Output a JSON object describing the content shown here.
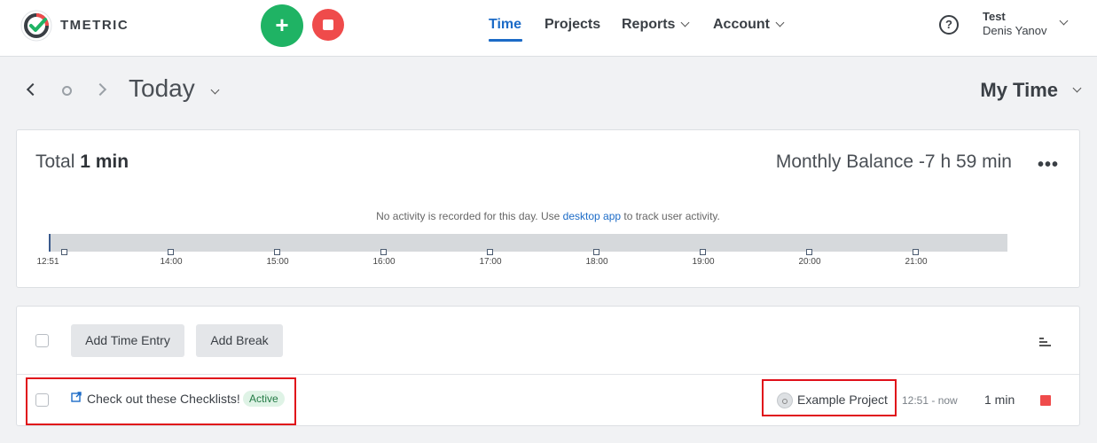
{
  "header": {
    "brand": "TMETRIC",
    "start_button": "+",
    "nav": [
      {
        "label": "Time",
        "active": true
      },
      {
        "label": "Projects",
        "active": false
      },
      {
        "label": "Reports",
        "active": false,
        "dropdown": true
      },
      {
        "label": "Account",
        "active": false,
        "dropdown": true
      }
    ],
    "help": "?",
    "user": {
      "workspace": "Test",
      "name": "Denis Yanov"
    }
  },
  "datebar": {
    "title": "Today",
    "view": "My Time"
  },
  "summary": {
    "total_label": "Total",
    "total_value": "1 min",
    "balance_label": "Monthly Balance",
    "balance_value": "-7 h 59 min",
    "more": "•••",
    "activity_note_before": "No activity is recorded for this day. Use ",
    "activity_note_link": "desktop app",
    "activity_note_after": " to track user activity.",
    "timeline_ticks": [
      "12:51",
      "14:00",
      "15:00",
      "16:00",
      "17:00",
      "18:00",
      "19:00",
      "20:00",
      "21:00"
    ]
  },
  "entries": {
    "add_time_entry": "Add Time Entry",
    "add_break": "Add Break",
    "rows": [
      {
        "task": "Check out these Checklists!",
        "badge": "Active",
        "project": "Example Project",
        "time_range": "12:51 - now",
        "duration": "1 min"
      }
    ]
  },
  "colors": {
    "accent": "#1c6bc7",
    "start": "#1fb364",
    "stop": "#ef4b4b",
    "highlight": "#e0101a"
  }
}
